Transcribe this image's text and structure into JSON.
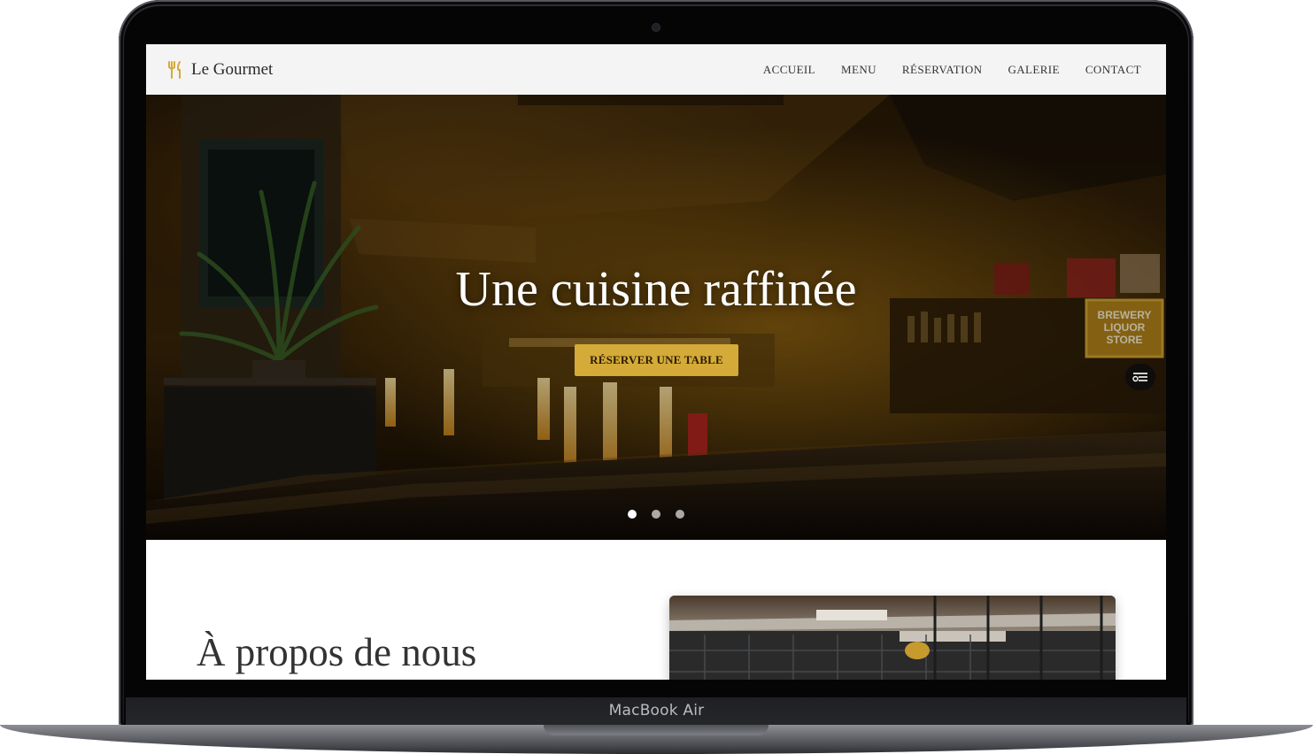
{
  "device": {
    "label": "MacBook Air"
  },
  "site": {
    "brand_name": "Le Gourmet",
    "brand_icon": "fork-knife-icon",
    "accent_color": "#d4aa38",
    "nav": [
      {
        "label": "ACCUEIL"
      },
      {
        "label": "MENU"
      },
      {
        "label": "RÉSERVATION"
      },
      {
        "label": "GALERIE"
      },
      {
        "label": "CONTACT"
      }
    ]
  },
  "hero": {
    "title": "Une cuisine raffinée",
    "cta_label": "RÉSERVER UNE TABLE",
    "filter_icon": "filter-sliders-icon",
    "slides_total": 3,
    "active_slide": 1
  },
  "about": {
    "heading": "À propos de nous"
  }
}
